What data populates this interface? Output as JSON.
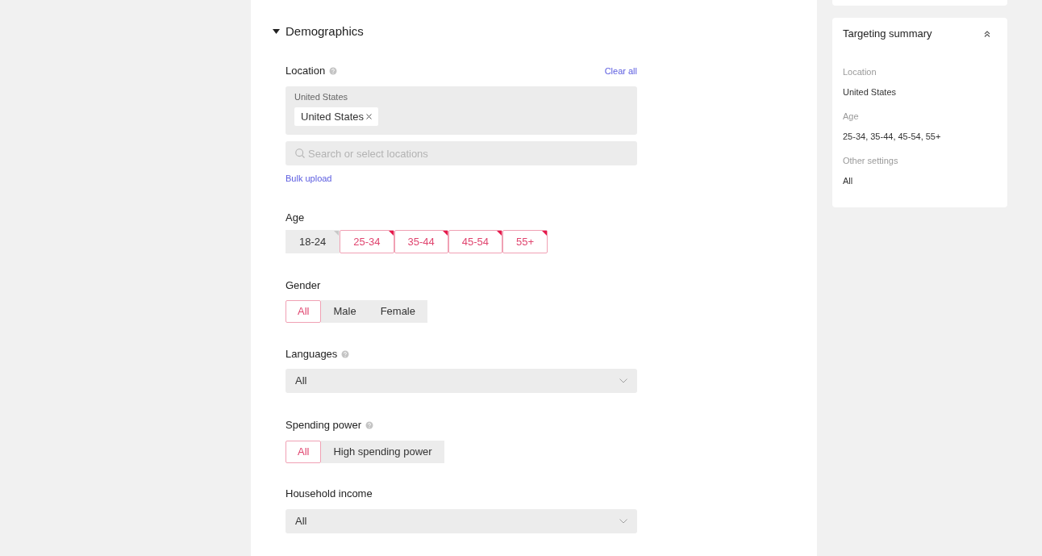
{
  "section": {
    "title": "Demographics",
    "expanded": true
  },
  "location": {
    "label": "Location",
    "help": true,
    "clear_action": "Clear all",
    "group_label": "United States",
    "chips": [
      {
        "label": "United States"
      }
    ],
    "search": {
      "placeholder": "Search or select locations"
    },
    "bulk_upload": "Bulk upload"
  },
  "age": {
    "label": "Age",
    "options": [
      {
        "label": "18-24",
        "selected": false
      },
      {
        "label": "25-34",
        "selected": true
      },
      {
        "label": "35-44",
        "selected": true
      },
      {
        "label": "45-54",
        "selected": true
      },
      {
        "label": "55+",
        "selected": true
      }
    ]
  },
  "gender": {
    "label": "Gender",
    "options": [
      {
        "label": "All",
        "selected": true
      },
      {
        "label": "Male",
        "selected": false
      },
      {
        "label": "Female",
        "selected": false
      }
    ]
  },
  "languages": {
    "label": "Languages",
    "help": true,
    "value": "All"
  },
  "spending_power": {
    "label": "Spending power",
    "help": true,
    "options": [
      {
        "label": "All",
        "selected": true
      },
      {
        "label": "High spending power",
        "selected": false
      }
    ]
  },
  "household_income": {
    "label": "Household income",
    "value": "All"
  },
  "targeting_summary": {
    "title": "Targeting summary",
    "expanded": true,
    "items": [
      {
        "label": "Location",
        "value": "United States"
      },
      {
        "label": "Age",
        "value": "25-34, 35-44, 45-54, 55+"
      },
      {
        "label": "Other settings",
        "value": "All"
      }
    ]
  }
}
